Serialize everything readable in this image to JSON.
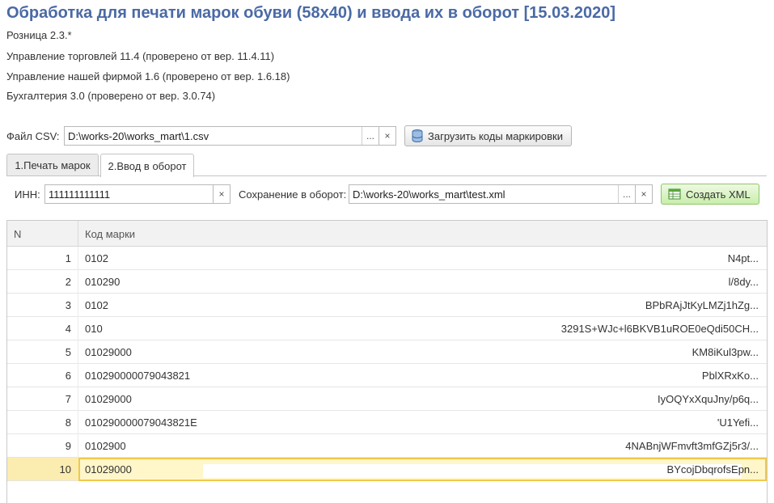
{
  "title": "Обработка для печати марок обуви (58х40) и ввода их в оборот [15.03.2020]",
  "info_lines": [
    "Розница 2.3.*",
    "Управление торговлей 11.4 (проверено от вер. 11.4.11)",
    "Управление нашей фирмой 1.6 (проверено от вер. 1.6.18)",
    "Бухгалтерия 3.0 (проверено от вер. 3.0.74)"
  ],
  "csv": {
    "label": "Файл CSV:",
    "value": "D:\\works-20\\works_mart\\1.csv",
    "select_label": "...",
    "clear_label": "×",
    "load_button": "Загрузить коды маркировки",
    "load_icon": "database-icon"
  },
  "tabs": [
    {
      "label": "1.Печать марок",
      "active": false
    },
    {
      "label": "2.Ввод в оборот",
      "active": true
    }
  ],
  "inn": {
    "label": "ИНН:",
    "value": "111111111111",
    "clear_label": "×"
  },
  "save": {
    "label": "Сохранение в оборот:",
    "value": "D:\\works-20\\works_mart\\test.xml",
    "select_label": "...",
    "clear_label": "×"
  },
  "create_xml": {
    "label": "Создать XML",
    "icon": "spreadsheet-icon"
  },
  "table": {
    "columns": [
      "N",
      "Код марки"
    ],
    "rows": [
      {
        "n": "1",
        "code": "0102",
        "tail": "N4pt..."
      },
      {
        "n": "2",
        "code": "010290",
        "tail": "l/8dy..."
      },
      {
        "n": "3",
        "code": "0102",
        "tail": "BPbRAjJtKyLMZj1hZg..."
      },
      {
        "n": "4",
        "code": "010",
        "tail": "3291S+WJc+l6BKVB1uROE0eQdi50CH..."
      },
      {
        "n": "5",
        "code": "01029000",
        "tail": "KM8iKul3pw..."
      },
      {
        "n": "6",
        "code": "010290000079043821",
        "tail": "PblXRxKo..."
      },
      {
        "n": "7",
        "code": "01029000",
        "tail": "IyOQYxXquJny/p6q..."
      },
      {
        "n": "8",
        "code": "010290000079043821E",
        "tail": "'U1Yefi..."
      },
      {
        "n": "9",
        "code": "0102900",
        "tail": "4NABnjWFmvft3mfGZj5r3/..."
      },
      {
        "n": "10",
        "code": "01029000",
        "tail": "BYcojDbqrofsEpn...",
        "selected": true
      }
    ]
  },
  "colors": {
    "title": "#4a6aa5",
    "selected_row": "#fbecb0",
    "selected_cell_border": "#f0c94a",
    "green_button": "#c9eeaa"
  }
}
